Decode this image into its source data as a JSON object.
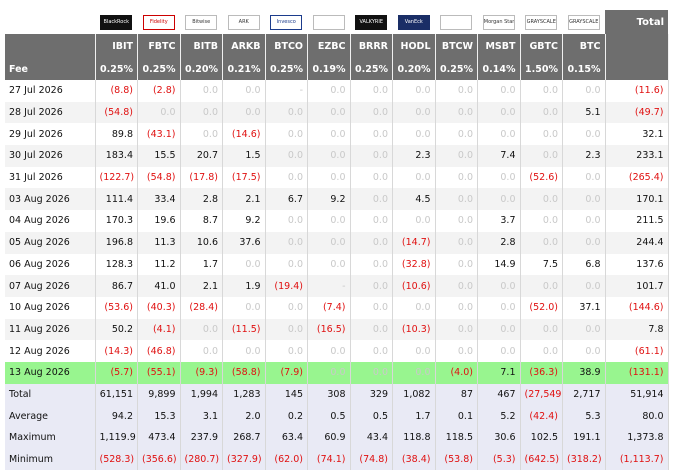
{
  "total_header": "Total",
  "logos": [
    {
      "text": "BlackRock",
      "style": "dark"
    },
    {
      "text": "Fidelity",
      "style": "red"
    },
    {
      "text": "Bitwise",
      "style": ""
    },
    {
      "text": "ARK",
      "style": ""
    },
    {
      "text": "Invesco",
      "style": "blue"
    },
    {
      "text": "",
      "style": ""
    },
    {
      "text": "VALKYRIE",
      "style": "dark"
    },
    {
      "text": "VanEck",
      "style": "navy"
    },
    {
      "text": "",
      "style": ""
    },
    {
      "text": "Morgan Stanley",
      "style": ""
    },
    {
      "text": "GRAYSCALE",
      "style": ""
    },
    {
      "text": "GRAYSCALE",
      "style": ""
    }
  ],
  "tickers": [
    "IBIT",
    "FBTC",
    "BITB",
    "ARKB",
    "BTCO",
    "EZBC",
    "BRRR",
    "HODL",
    "BTCW",
    "MSBT",
    "GBTC",
    "BTC"
  ],
  "fee_label": "Fee",
  "fees": [
    "0.25%",
    "0.25%",
    "0.20%",
    "0.21%",
    "0.25%",
    "0.19%",
    "0.25%",
    "0.20%",
    "0.25%",
    "0.14%",
    "1.50%",
    "0.15%"
  ],
  "rows": [
    {
      "date": "27 Jul 2026",
      "values": [
        "(8.8)",
        "(2.8)",
        "0.0",
        "0.0",
        "-",
        "0.0",
        "0.0",
        "0.0",
        "0.0",
        "0.0",
        "0.0",
        "0.0"
      ],
      "total": "(11.6)"
    },
    {
      "date": "28 Jul 2026",
      "values": [
        "(54.8)",
        "0.0",
        "0.0",
        "0.0",
        "0.0",
        "0.0",
        "0.0",
        "0.0",
        "0.0",
        "0.0",
        "0.0",
        "5.1"
      ],
      "total": "(49.7)"
    },
    {
      "date": "29 Jul 2026",
      "values": [
        "89.8",
        "(43.1)",
        "0.0",
        "(14.6)",
        "0.0",
        "0.0",
        "0.0",
        "0.0",
        "0.0",
        "0.0",
        "0.0",
        "0.0"
      ],
      "total": "32.1"
    },
    {
      "date": "30 Jul 2026",
      "values": [
        "183.4",
        "15.5",
        "20.7",
        "1.5",
        "0.0",
        "0.0",
        "0.0",
        "2.3",
        "0.0",
        "7.4",
        "0.0",
        "2.3"
      ],
      "total": "233.1"
    },
    {
      "date": "31 Jul 2026",
      "values": [
        "(122.7)",
        "(54.8)",
        "(17.8)",
        "(17.5)",
        "0.0",
        "0.0",
        "0.0",
        "0.0",
        "0.0",
        "0.0",
        "(52.6)",
        "0.0"
      ],
      "total": "(265.4)"
    },
    {
      "date": "03 Aug 2026",
      "values": [
        "111.4",
        "33.4",
        "2.8",
        "2.1",
        "6.7",
        "9.2",
        "0.0",
        "4.5",
        "0.0",
        "0.0",
        "0.0",
        "0.0"
      ],
      "total": "170.1"
    },
    {
      "date": "04 Aug 2026",
      "values": [
        "170.3",
        "19.6",
        "8.7",
        "9.2",
        "0.0",
        "0.0",
        "0.0",
        "0.0",
        "0.0",
        "3.7",
        "0.0",
        "0.0"
      ],
      "total": "211.5"
    },
    {
      "date": "05 Aug 2026",
      "values": [
        "196.8",
        "11.3",
        "10.6",
        "37.6",
        "0.0",
        "0.0",
        "0.0",
        "(14.7)",
        "0.0",
        "2.8",
        "0.0",
        "0.0"
      ],
      "total": "244.4"
    },
    {
      "date": "06 Aug 2026",
      "values": [
        "128.3",
        "11.2",
        "1.7",
        "0.0",
        "0.0",
        "0.0",
        "0.0",
        "(32.8)",
        "0.0",
        "14.9",
        "7.5",
        "6.8"
      ],
      "total": "137.6"
    },
    {
      "date": "07 Aug 2026",
      "values": [
        "86.7",
        "41.0",
        "2.1",
        "1.9",
        "(19.4)",
        "-",
        "0.0",
        "(10.6)",
        "0.0",
        "0.0",
        "0.0",
        "0.0"
      ],
      "total": "101.7"
    },
    {
      "date": "10 Aug 2026",
      "values": [
        "(53.6)",
        "(40.3)",
        "(28.4)",
        "0.0",
        "0.0",
        "(7.4)",
        "0.0",
        "0.0",
        "0.0",
        "0.0",
        "(52.0)",
        "37.1"
      ],
      "total": "(144.6)"
    },
    {
      "date": "11 Aug 2026",
      "values": [
        "50.2",
        "(4.1)",
        "0.0",
        "(11.5)",
        "0.0",
        "(16.5)",
        "0.0",
        "(10.3)",
        "0.0",
        "0.0",
        "0.0",
        "0.0"
      ],
      "total": "7.8"
    },
    {
      "date": "12 Aug 2026",
      "values": [
        "(14.3)",
        "(46.8)",
        "0.0",
        "0.0",
        "0.0",
        "0.0",
        "0.0",
        "0.0",
        "0.0",
        "0.0",
        "0.0",
        "0.0"
      ],
      "total": "(61.1)"
    },
    {
      "date": "13 Aug 2026",
      "values": [
        "(5.7)",
        "(55.1)",
        "(9.3)",
        "(58.8)",
        "(7.9)",
        "0.0",
        "0.0",
        "0.0",
        "(4.0)",
        "7.1",
        "(36.3)",
        "38.9"
      ],
      "total": "(131.1)",
      "highlight": true
    }
  ],
  "stats": [
    {
      "label": "Total",
      "values": [
        "61,151",
        "9,899",
        "1,994",
        "1,283",
        "145",
        "308",
        "329",
        "1,082",
        "87",
        "467",
        "(27,549)",
        "2,717"
      ],
      "total": "51,914"
    },
    {
      "label": "Average",
      "values": [
        "94.2",
        "15.3",
        "3.1",
        "2.0",
        "0.2",
        "0.5",
        "0.5",
        "1.7",
        "0.1",
        "5.2",
        "(42.4)",
        "5.3"
      ],
      "total": "80.0"
    },
    {
      "label": "Maximum",
      "values": [
        "1,119.9",
        "473.4",
        "237.9",
        "268.7",
        "63.4",
        "60.9",
        "43.4",
        "118.8",
        "118.5",
        "30.6",
        "102.5",
        "191.1"
      ],
      "total": "1,373.8"
    },
    {
      "label": "Minimum",
      "values": [
        "(528.3)",
        "(356.6)",
        "(280.7)",
        "(327.9)",
        "(62.0)",
        "(74.1)",
        "(74.8)",
        "(38.4)",
        "(53.8)",
        "(5.3)",
        "(642.5)",
        "(318.2)"
      ],
      "total": "(1,113.7)"
    }
  ]
}
